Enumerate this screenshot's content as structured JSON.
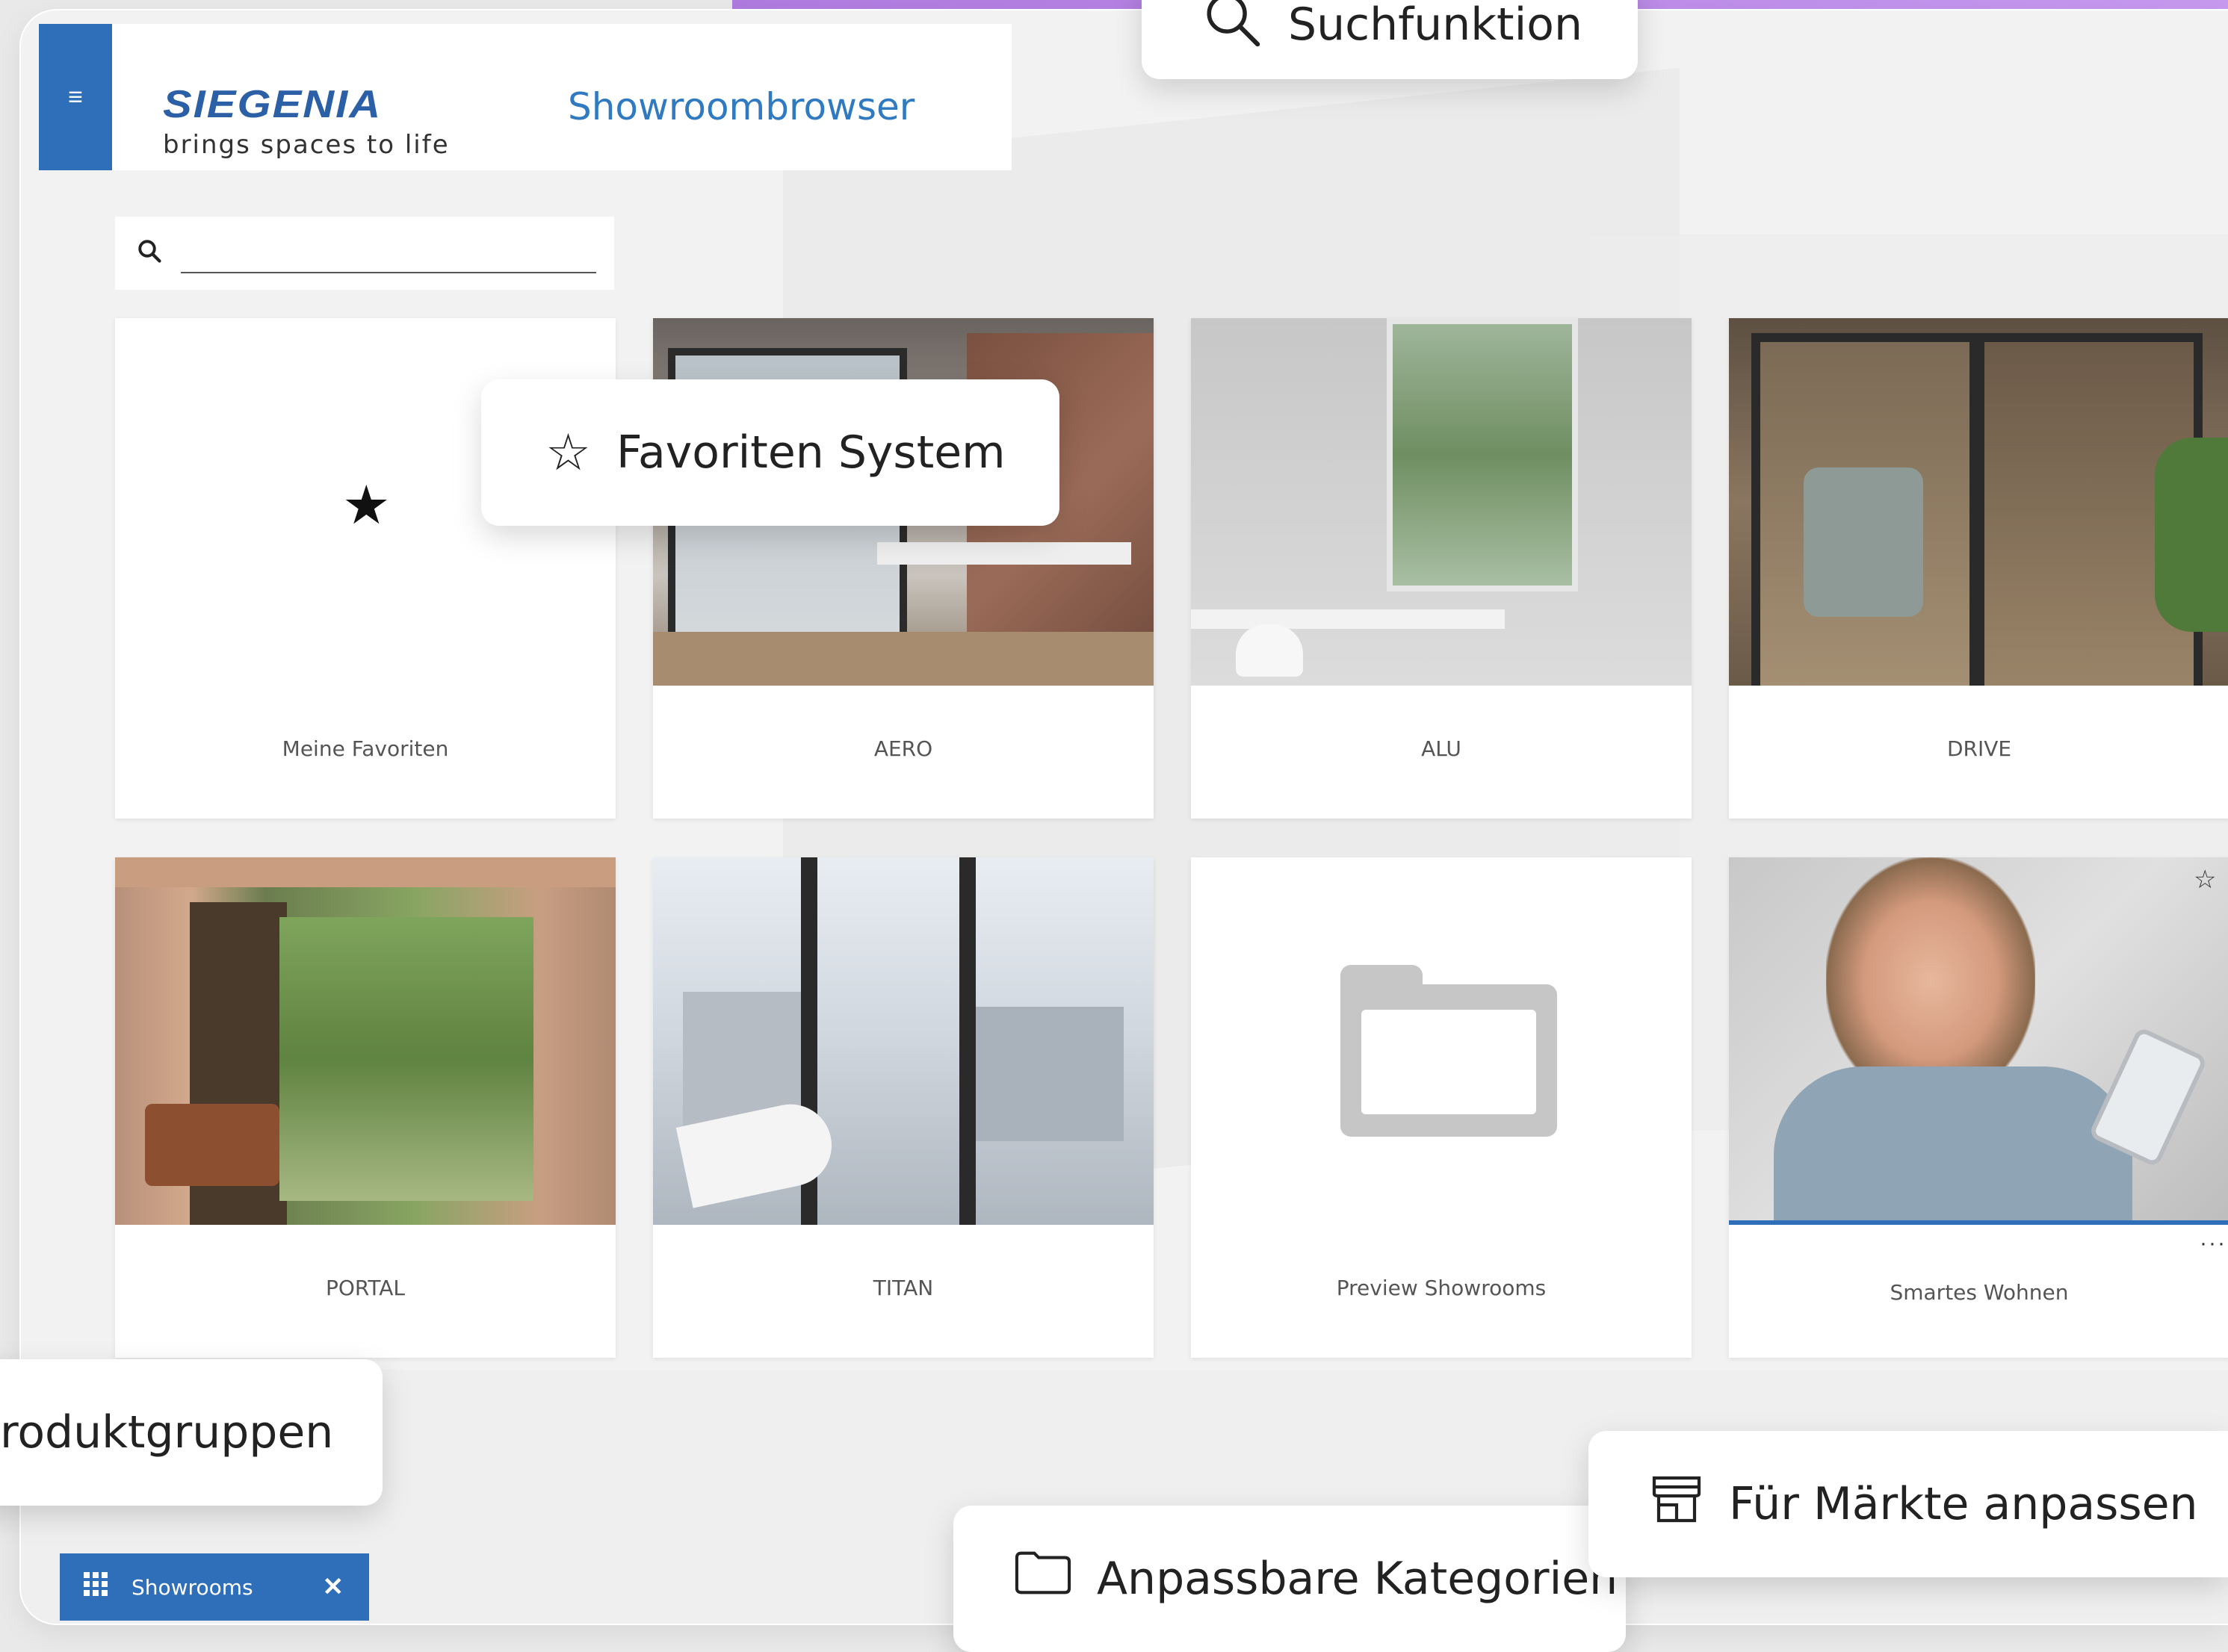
{
  "header": {
    "brand_name": "SIEGENIA",
    "brand_tagline": "brings spaces to life",
    "app_title": "Showroombrowser",
    "menu_icon": "hamburger-menu-icon"
  },
  "search": {
    "placeholder": "",
    "value": ""
  },
  "tiles": [
    {
      "label": "Meine Favoriten"
    },
    {
      "label": "AERO"
    },
    {
      "label": "ALU"
    },
    {
      "label": "DRIVE"
    },
    {
      "label": "PORTAL"
    },
    {
      "label": "TITAN"
    },
    {
      "label": "Preview Showrooms"
    },
    {
      "label": "Smartes Wohnen"
    }
  ],
  "callouts": {
    "search": "Suchfunktion",
    "favorites": "Favoriten System",
    "product_groups": "roduktgruppen",
    "markets": "Für Märkte anpassen",
    "categories": "Anpassbare Kategorien"
  },
  "bottom_tab": {
    "label": "Showrooms",
    "close": "✕"
  },
  "colors": {
    "brand_blue": "#2f6eb9",
    "title_blue": "#2f7ac0",
    "accent_purple": "#b07be0"
  }
}
